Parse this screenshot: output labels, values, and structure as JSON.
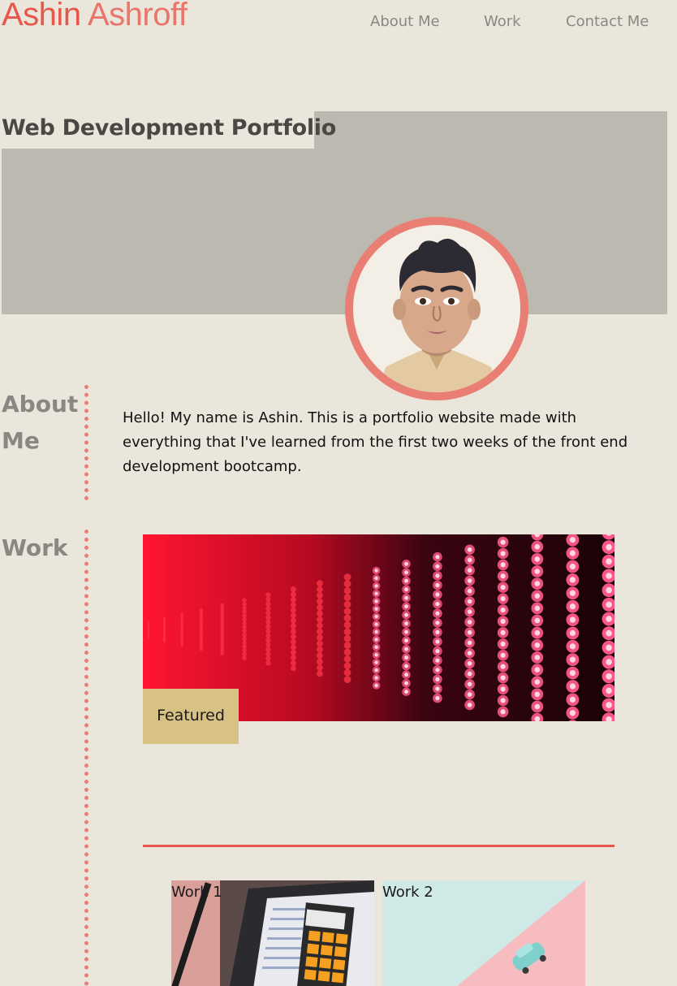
{
  "header": {
    "brand_first": "Ashin",
    "brand_last": "Ashroff",
    "nav": [
      "About Me",
      "Work",
      "Contact Me"
    ]
  },
  "hero": {
    "title": "Web Development Portfolio"
  },
  "about": {
    "heading": "About Me",
    "text": "Hello! My name is Ashin. This is a portfolio website made with everything that I've learned from the first two weeks of the front end development bootcamp."
  },
  "work": {
    "heading": "Work",
    "featured_label": "Featured",
    "tiles": [
      "Work 1",
      "Work 2"
    ]
  },
  "colors": {
    "accent": "#e8574c",
    "background": "#eae6dc",
    "hero_band": "#bcb9b0",
    "featured_tag": "#d8c283"
  }
}
